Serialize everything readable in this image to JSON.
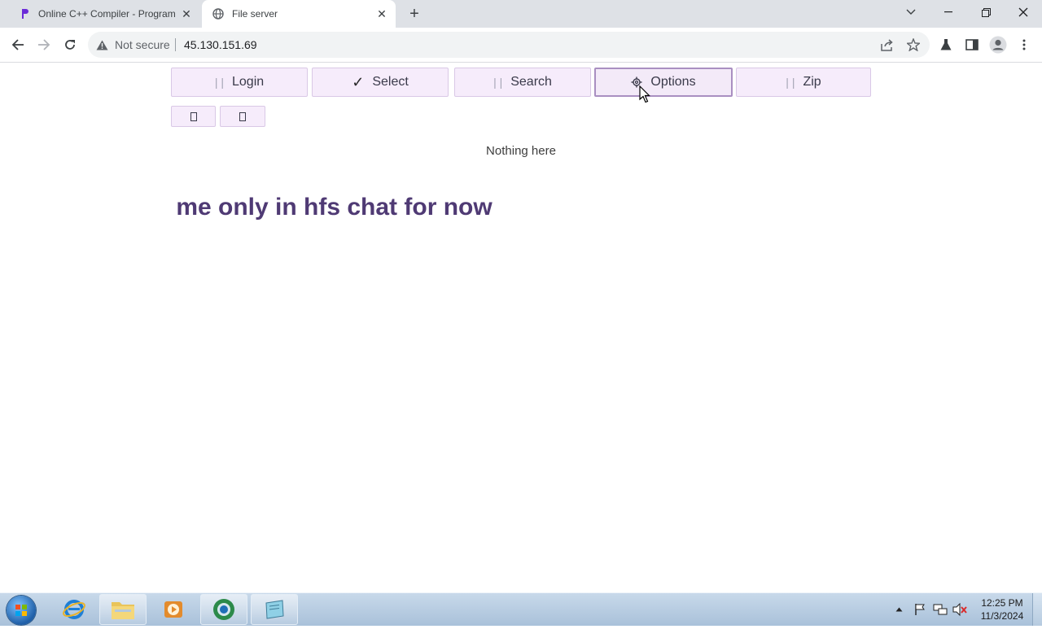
{
  "browser": {
    "tabs": [
      {
        "title": "Online C++ Compiler - Program",
        "active": false
      },
      {
        "title": "File server",
        "active": true
      }
    ],
    "security_label": "Not secure",
    "url": "45.130.151.69"
  },
  "toolbar_buttons": {
    "login": "Login",
    "select": "Select",
    "search": "Search",
    "options": "Options",
    "zip": "Zip"
  },
  "small_buttons": [
    "",
    ""
  ],
  "content": {
    "empty_message": "Nothing here",
    "marquee_text": ": me only in hfs chat for now"
  },
  "taskbar": {
    "time": "12:25 PM",
    "date": "11/3/2024"
  },
  "colors": {
    "accent_purple": "#4f3a74",
    "button_bg": "#f6ecfb",
    "button_border": "#d9c8e6"
  }
}
